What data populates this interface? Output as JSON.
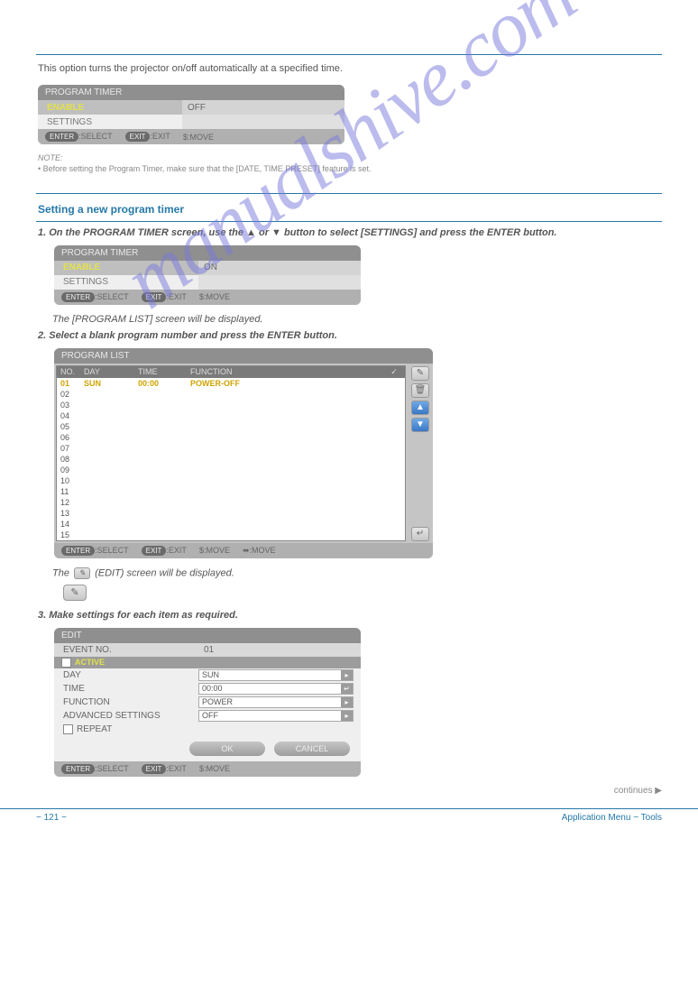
{
  "watermark": "manualshive.com",
  "lead_text": "This option turns the projector on/off automatically at a specified time.",
  "osd1": {
    "title": "PROGRAM TIMER",
    "enable_label": "ENABLE",
    "enable_value": "OFF",
    "settings_label": "SETTINGS",
    "foot_enter": "ENTER",
    "foot_select": ":SELECT",
    "foot_exitpill": "EXIT",
    "foot_exit": ":EXIT",
    "foot_move": "$:MOVE"
  },
  "note1_label": "NOTE:",
  "note1_text": "• Before setting the Program Timer, make sure that the [DATE, TIME PRESET] feature is set.",
  "section_title": "Setting a new program timer",
  "step1_title": "1. On the PROGRAM TIMER screen, use the ▲ or ▼ button to select [SETTINGS] and press the ENTER button.",
  "osd2": {
    "title": "PROGRAM TIMER",
    "enable_label": "ENABLE",
    "enable_value": "ON",
    "settings_label": "SETTINGS"
  },
  "step1_note": "The [PROGRAM LIST] screen will be displayed.",
  "step2_title": "2. Select a blank program number and press the ENTER button.",
  "programlist": {
    "title": "PROGRAM LIST",
    "head_no": "NO.",
    "head_day": "DAY",
    "head_time": "TIME",
    "head_fn": "FUNCTION",
    "rows": [
      {
        "no": "01",
        "day": "SUN",
        "time": "00:00",
        "fn": "POWER-OFF"
      },
      {
        "no": "02"
      },
      {
        "no": "03"
      },
      {
        "no": "04"
      },
      {
        "no": "05"
      },
      {
        "no": "06"
      },
      {
        "no": "07"
      },
      {
        "no": "08"
      },
      {
        "no": "09"
      },
      {
        "no": "10"
      },
      {
        "no": "11"
      },
      {
        "no": "12"
      },
      {
        "no": "13"
      },
      {
        "no": "14"
      },
      {
        "no": "15"
      }
    ],
    "foot_move2": "⬌:MOVE"
  },
  "step2_note_a": "The ",
  "step2_note_b": " (EDIT) screen will be displayed.",
  "step3_title": "3. Make settings for each item as required.",
  "edit": {
    "title": "EDIT",
    "event_no_label": "EVENT NO.",
    "event_no_value": "01",
    "active_label": "ACTIVE",
    "day_label": "DAY",
    "day_value": "SUN",
    "time_label": "TIME",
    "time_value": "00:00",
    "function_label": "FUNCTION",
    "function_value": "POWER",
    "advanced_label": "ADVANCED SETTINGS",
    "advanced_value": "OFF",
    "repeat_label": "REPEAT",
    "ok": "OK",
    "cancel": "CANCEL"
  },
  "continues": "continues ▶",
  "footer_left": "− 121 −",
  "footer_right": "Application Menu − Tools"
}
